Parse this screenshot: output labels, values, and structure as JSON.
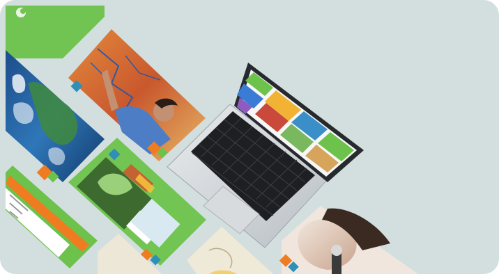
{
  "scene": {
    "description_visible_text": [],
    "background_color": "#d3dfdf",
    "accent_green": "#6cc24a",
    "accent_orange": "#f07c22",
    "icons": [
      "laptop-icon",
      "keyboard-icon",
      "trackpad-icon"
    ]
  }
}
